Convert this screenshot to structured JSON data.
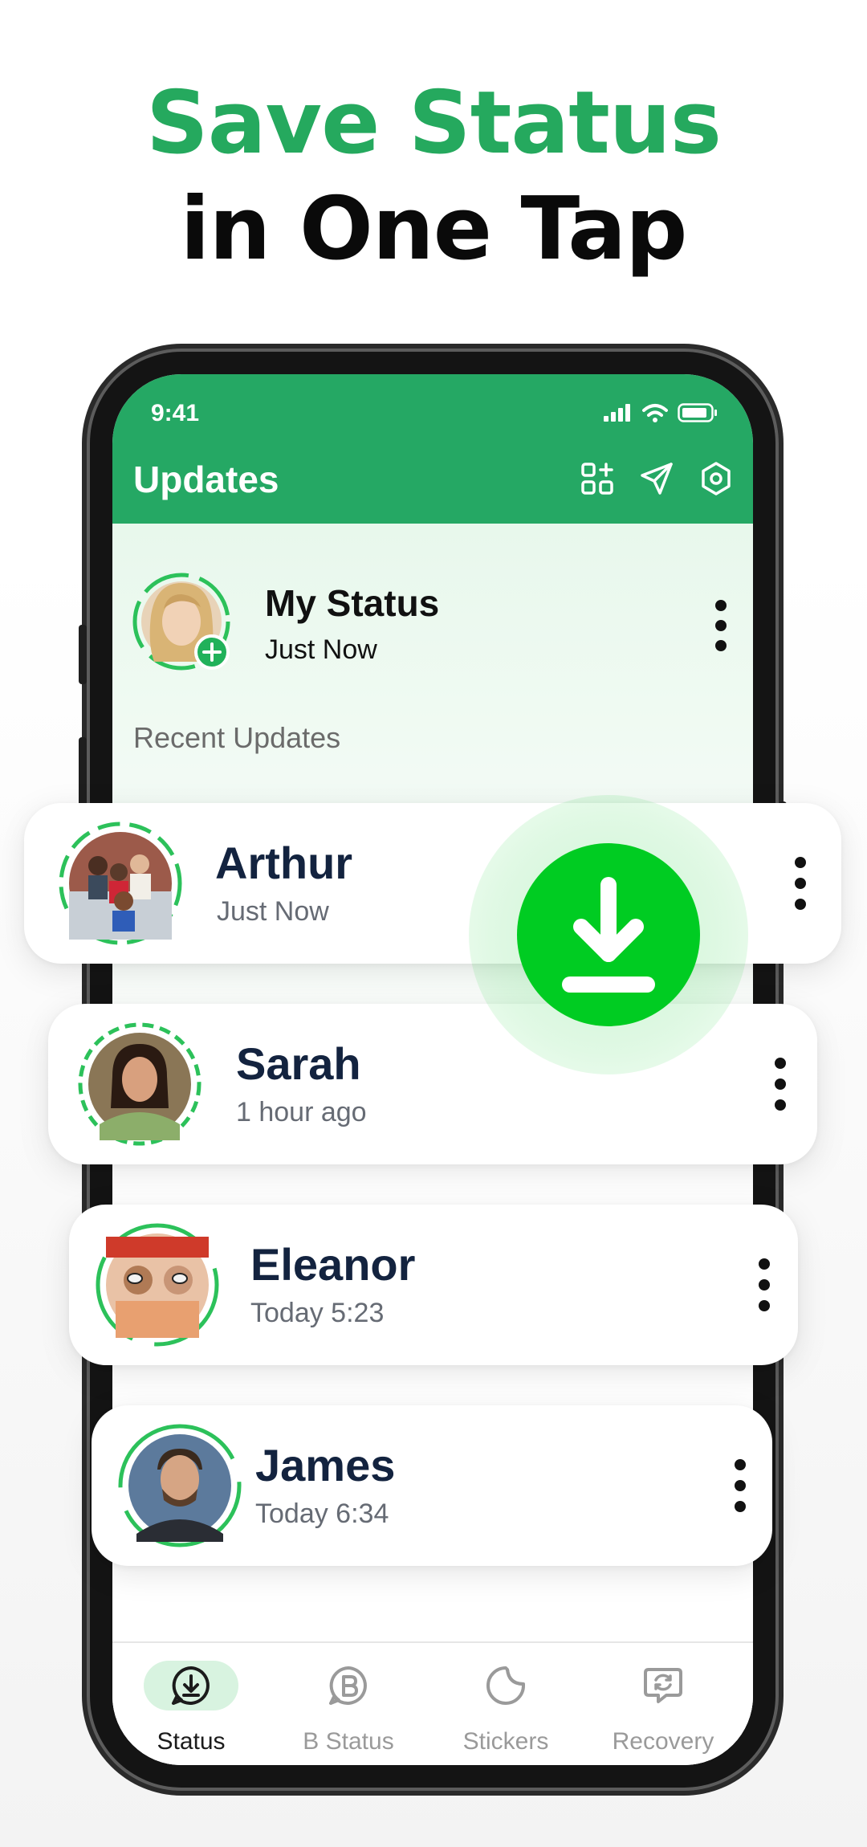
{
  "headline": {
    "line1": "Save Status",
    "line2": "in One Tap"
  },
  "statusbar": {
    "time": "9:41"
  },
  "appbar": {
    "title": "Updates",
    "actions": [
      "grid-add-icon",
      "send-icon",
      "settings-icon"
    ]
  },
  "my_status": {
    "name": "My Status",
    "time": "Just Now"
  },
  "section": {
    "recent_label": "Recent Updates"
  },
  "updates": [
    {
      "name": "Arthur",
      "time": "Just Now"
    },
    {
      "name": "Sarah",
      "time": "1 hour ago"
    },
    {
      "name": "Eleanor",
      "time": "Today 5:23"
    },
    {
      "name": "James",
      "time": "Today 6:34"
    }
  ],
  "bottom_nav": [
    {
      "label": "Status",
      "icon": "download-chat-icon",
      "active": true
    },
    {
      "label": "B Status",
      "icon": "business-chat-icon",
      "active": false
    },
    {
      "label": "Stickers",
      "icon": "sticker-icon",
      "active": false
    },
    {
      "label": "Recovery",
      "icon": "recovery-chat-icon",
      "active": false
    }
  ],
  "colors": {
    "brand_green": "#25a864",
    "headline_green": "#25a95e",
    "download_green": "#00cc22",
    "ring_green": "#2cc15a",
    "name_navy": "#13233f"
  }
}
